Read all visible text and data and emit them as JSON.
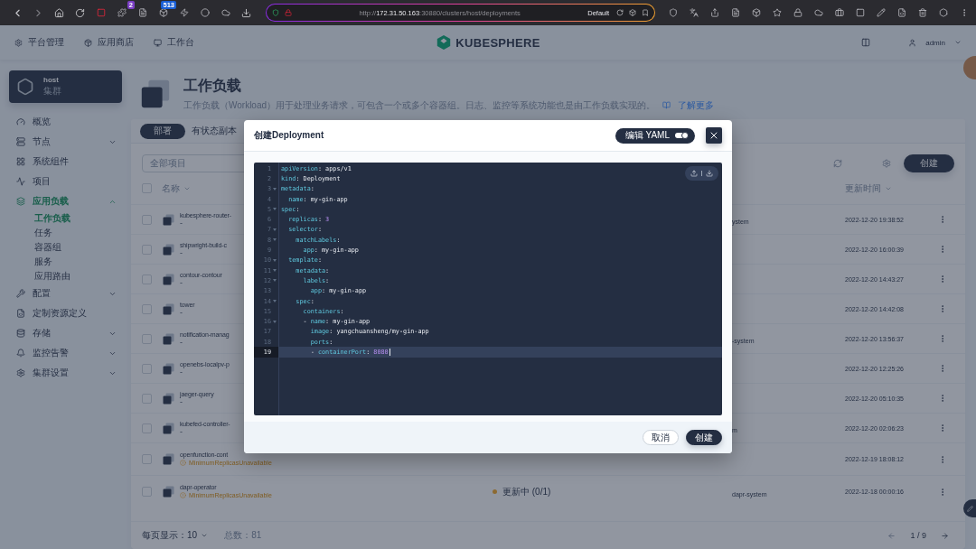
{
  "browser": {
    "url_parts": [
      {
        "text": "http://",
        "strong": false
      },
      {
        "text": "172.31.50.163",
        "strong": true
      },
      {
        "text": ":30880/clusters/host/deployments",
        "strong": false
      }
    ],
    "profile": "Default",
    "extension_badges": [
      {
        "text": "2",
        "color": "#7b3fc4"
      },
      {
        "text": "513",
        "color": "#1a5fd6"
      }
    ]
  },
  "top_nav": {
    "items": [
      {
        "label": "平台管理"
      },
      {
        "label": "应用商店"
      },
      {
        "label": "工作台"
      }
    ],
    "logo": "KUBESPHERE",
    "user": "admin"
  },
  "cluster": {
    "name": "host",
    "type": "集群"
  },
  "sidebar": {
    "items": [
      {
        "label": "概览",
        "kind": "link",
        "selected": false
      },
      {
        "label": "节点",
        "kind": "group",
        "expanded": false,
        "selected": false
      },
      {
        "label": "系统组件",
        "kind": "link",
        "selected": false
      },
      {
        "label": "项目",
        "kind": "link",
        "selected": false
      },
      {
        "label": "应用负载",
        "kind": "group",
        "expanded": true,
        "selected": true,
        "children": [
          {
            "label": "工作负载",
            "selected": true
          },
          {
            "label": "任务",
            "selected": false
          },
          {
            "label": "容器组",
            "selected": false
          },
          {
            "label": "服务",
            "selected": false
          },
          {
            "label": "应用路由",
            "selected": false
          }
        ]
      },
      {
        "label": "配置",
        "kind": "group",
        "expanded": false,
        "selected": false
      },
      {
        "label": "定制资源定义",
        "kind": "link",
        "selected": false
      },
      {
        "label": "存储",
        "kind": "group",
        "expanded": false,
        "selected": false
      },
      {
        "label": "监控告警",
        "kind": "group",
        "expanded": false,
        "selected": false
      },
      {
        "label": "集群设置",
        "kind": "group",
        "expanded": false,
        "selected": false
      }
    ]
  },
  "page": {
    "title": "工作负载",
    "description": "工作负载（Workload）用于处理业务请求，可包含一个或多个容器组。日志、监控等系统功能也是由工作负载实现的。",
    "link": "了解更多"
  },
  "tabs": [
    {
      "label": "部署",
      "selected": true
    },
    {
      "label": "有状态副本",
      "selected": false
    }
  ],
  "toolbar": {
    "filter": "全部项目",
    "create": "创建"
  },
  "table": {
    "all_checked": false,
    "columns": [
      {
        "label": "名称"
      },
      {
        "label": "更新时间"
      }
    ],
    "rows": [
      {
        "name": "kubesphere-router-",
        "description": "-",
        "warning": false,
        "checked": false,
        "project": "ystem",
        "updated": "2022-12-20 19:38:52"
      },
      {
        "name": "shipwright-build-c",
        "description": "-",
        "warning": false,
        "checked": false,
        "updated": "2022-12-20 16:00:39"
      },
      {
        "name": "contour-contour",
        "description": "-",
        "warning": false,
        "checked": false,
        "updated": "2022-12-20 14:43:27"
      },
      {
        "name": "tower",
        "description": "-",
        "warning": false,
        "checked": false,
        "updated": "2022-12-20 14:42:08"
      },
      {
        "name": "notification-manag",
        "description": "-",
        "warning": false,
        "checked": false,
        "project": "-system",
        "updated": "2022-12-20 13:56:37"
      },
      {
        "name": "openebs-localpv-p",
        "description": "-",
        "warning": false,
        "checked": false,
        "updated": "2022-12-20 12:25:26"
      },
      {
        "name": "jaeger-query",
        "description": "-",
        "warning": false,
        "checked": false,
        "updated": "2022-12-20 05:10:35"
      },
      {
        "name": "kubefed-controller-",
        "description": "-",
        "warning": false,
        "checked": false,
        "project": "m",
        "updated": "2022-12-20 02:06:23"
      },
      {
        "name": "openfunction-cont",
        "description": "MinimumReplicasUnavailable",
        "warning": true,
        "checked": false,
        "updated": "2022-12-19 18:08:12"
      },
      {
        "name": "dapr-operator",
        "description": "MinimumReplicasUnavailable",
        "warning": true,
        "checked": false,
        "status": "更新中 (0/1)",
        "project": "dapr-system",
        "updated": "2022-12-18 00:00:16"
      }
    ]
  },
  "footer": {
    "page_size": "每页显示：10",
    "total": "总数：81",
    "page": "1 / 9"
  },
  "modal": {
    "title": "创建Deployment",
    "yaml_toggle": {
      "label": "编辑 YAML",
      "on": true
    },
    "lines": [
      {
        "number": "1",
        "text": "apiVersion: apps/v1",
        "foldable": false,
        "active": false
      },
      {
        "number": "2",
        "text": "kind: Deployment",
        "foldable": false,
        "active": false
      },
      {
        "number": "3",
        "text": "metadata:",
        "foldable": true,
        "active": false
      },
      {
        "number": "4",
        "text": "  name: my-gin-app",
        "foldable": false,
        "active": false
      },
      {
        "number": "5",
        "text": "spec:",
        "foldable": true,
        "active": false
      },
      {
        "number": "6",
        "text": "  replicas: 3",
        "foldable": false,
        "active": false
      },
      {
        "number": "7",
        "text": "  selector:",
        "foldable": true,
        "active": false
      },
      {
        "number": "8",
        "text": "    matchLabels:",
        "foldable": true,
        "active": false
      },
      {
        "number": "9",
        "text": "      app: my-gin-app",
        "foldable": false,
        "active": false
      },
      {
        "number": "10",
        "text": "  template:",
        "foldable": true,
        "active": false
      },
      {
        "number": "11",
        "text": "    metadata:",
        "foldable": true,
        "active": false
      },
      {
        "number": "12",
        "text": "      labels:",
        "foldable": true,
        "active": false
      },
      {
        "number": "13",
        "text": "        app: my-gin-app",
        "foldable": false,
        "active": false
      },
      {
        "number": "14",
        "text": "    spec:",
        "foldable": true,
        "active": false
      },
      {
        "number": "15",
        "text": "      containers:",
        "foldable": false,
        "active": false
      },
      {
        "number": "16",
        "text": "      - name: my-gin-app",
        "foldable": true,
        "active": false
      },
      {
        "number": "17",
        "text": "        image: yangchuansheng/my-gin-app",
        "foldable": false,
        "active": false
      },
      {
        "number": "18",
        "text": "        ports:",
        "foldable": false,
        "active": false
      },
      {
        "number": "19",
        "text": "        - containerPort: 8080",
        "foldable": false,
        "active": true
      }
    ],
    "buttons": [
      {
        "label": "取消",
        "kind": "secondary"
      },
      {
        "label": "创建",
        "kind": "primary"
      }
    ]
  }
}
